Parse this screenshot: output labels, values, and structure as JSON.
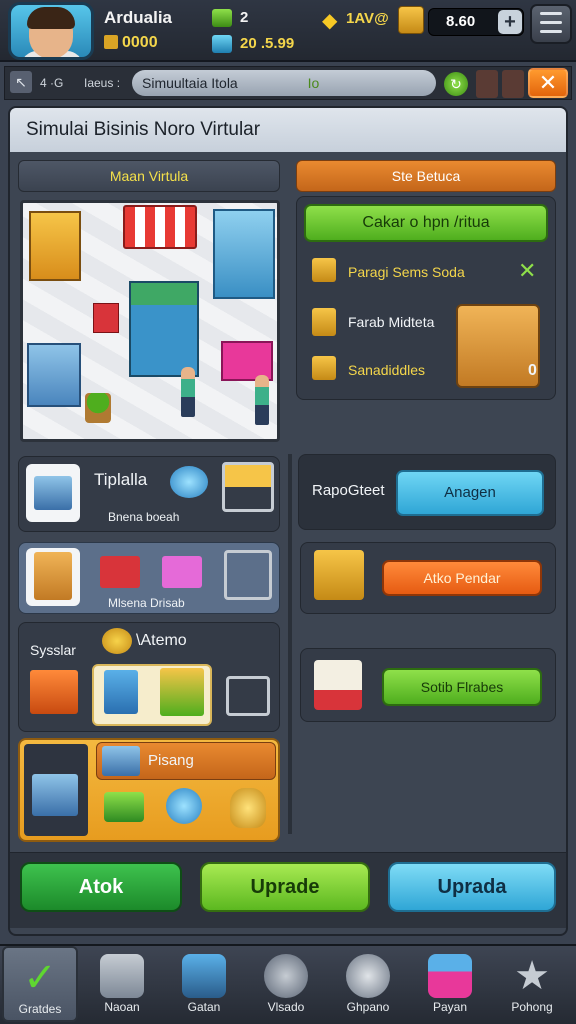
{
  "profile": {
    "name": "Ardualia",
    "coins": "0000"
  },
  "stats": {
    "gems": "2",
    "cash": "20 .5.99",
    "stars": "1AV@",
    "gold": "8.60"
  },
  "browser": {
    "tab_text": "4 ·G",
    "label": "Iaeus :",
    "url": "Simuultaia Itola",
    "url_suffix": "Io",
    "close": "✕"
  },
  "window_title": "Simulai Bisinis Noro Virtular",
  "left_header": "Maan Virtula",
  "right_header": "Ste Betuca",
  "right_panel": {
    "main_button": "Cakar o hpn /ritua",
    "rows": [
      {
        "label": "Paragi Sems Soda",
        "has_check": true
      },
      {
        "label": "Farab Midteta",
        "has_check": false
      },
      {
        "label": "Sanadiddles",
        "has_check": false
      }
    ],
    "badge": "0"
  },
  "left_cards": [
    {
      "title": "Tiplalla",
      "subtitle": "Bnena boeah"
    },
    {
      "title": "",
      "subtitle": "Mlsena Drisab"
    },
    {
      "side_label": "Sysslar",
      "title": "\\Atemo"
    },
    {
      "title": "Pisang"
    }
  ],
  "right_cards": [
    {
      "label": "RapoGteet",
      "button": "Anagen"
    },
    {
      "button": "Atko Pendar"
    },
    {
      "button": "Sotib Flrabes"
    }
  ],
  "actions": [
    "Atok",
    "Uprade",
    "Uprada"
  ],
  "nav": [
    {
      "label": "Gratdes",
      "icon": "check-icon"
    },
    {
      "label": "Naoan",
      "icon": "box-icon"
    },
    {
      "label": "Gatan",
      "icon": "stack-icon"
    },
    {
      "label": "Vlsado",
      "icon": "globe-icon"
    },
    {
      "label": "Ghpano",
      "icon": "dial-icon"
    },
    {
      "label": "Payan",
      "icon": "building-icon"
    },
    {
      "label": "Pohong",
      "icon": "star-icon"
    }
  ],
  "colors": {
    "accent_green": "#4fae1e",
    "accent_blue": "#2fa6d6",
    "accent_orange": "#e65b12",
    "panel": "#3d4552"
  }
}
